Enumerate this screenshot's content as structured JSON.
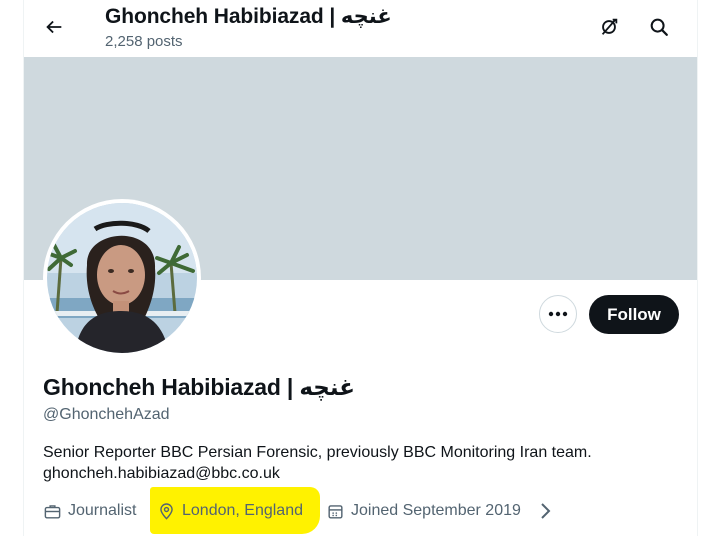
{
  "header": {
    "title": "Ghoncheh Habibiazad | غنچه",
    "post_count": "2,258 posts",
    "icons": [
      "back-arrow-icon",
      "gift-icon",
      "search-icon"
    ]
  },
  "profile": {
    "display_name": "Ghoncheh Habibiazad | غنچه",
    "handle": "@GhonchehAzad",
    "bio_line1": "Senior Reporter BBC Persian Forensic, previously BBC Monitoring Iran team.",
    "bio_line2": "ghoncheh.habibiazad@bbc.co.uk",
    "follow_label": "Follow",
    "more_icon": "more-dots-icon"
  },
  "meta": {
    "category": "Journalist",
    "location": "London, England",
    "joined": "Joined September 2019"
  },
  "colors": {
    "banner": "#cfd9de",
    "text_primary": "#0f1419",
    "text_secondary": "#536471",
    "follow_bg": "#0f1419",
    "highlight": "#fff200"
  }
}
